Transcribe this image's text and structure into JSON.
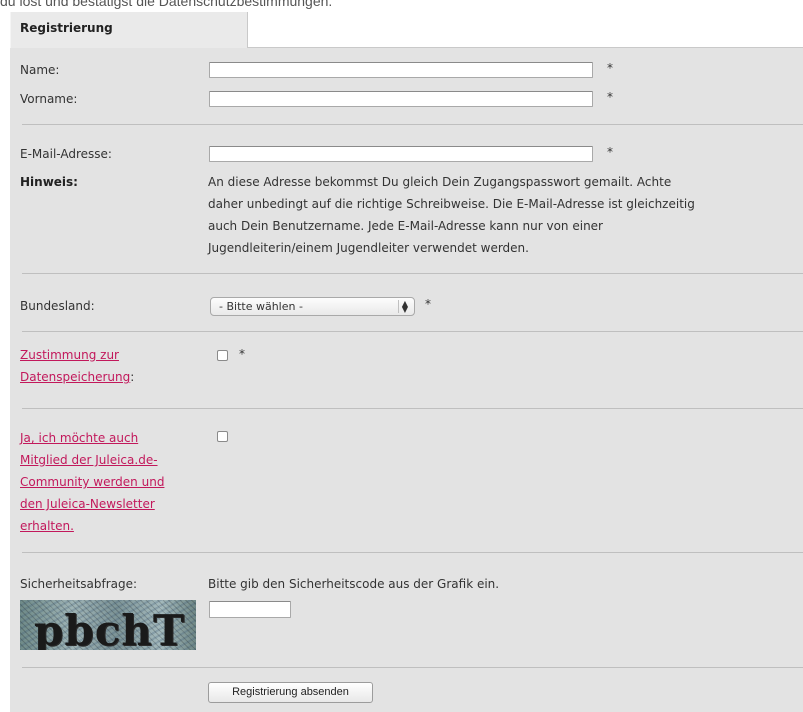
{
  "intro_text": "du löst und bestätigst die Datenschutzbestimmungen.",
  "form": {
    "tab_title": "Registrierung",
    "name_label": "Name:",
    "vorname_label": "Vorname:",
    "email_label": "E-Mail-Adresse:",
    "hinweis_label": "Hinweis:",
    "hinweis_lines": [
      "An diese Adresse bekommst Du gleich Dein Zugangspasswort gemailt. Achte",
      "daher unbedingt auf die richtige Schreibweise. Die E-Mail-Adresse ist gleichzeitig",
      "auch Dein Benutzername. Jede E-Mail-Adresse kann nur von einer",
      "Jugendleiterin/einem Jugendleiter verwendet werden."
    ],
    "bundesland_label": "Bundesland:",
    "bundesland_selected": "- Bitte wählen -",
    "zustimmung_lines": [
      "Zustimmung zur",
      "Datenspeicherung"
    ],
    "zustimmung_suffix": ":",
    "newsletter_lines": [
      "Ja, ich möchte auch",
      "Mitglied der Juleica.de-",
      "Community werden und",
      "den Juleica-Newsletter",
      "erhalten."
    ],
    "security_label": "Sicherheitsabfrage:",
    "security_instruction": "Bitte gib den Sicherheitscode aus der Grafik ein.",
    "captcha_text": "pbchT",
    "submit_label": "Registrierung absenden",
    "required_mark": "*",
    "inputs": {
      "name": "",
      "vorname": "",
      "email": "",
      "security_code": ""
    }
  },
  "colors": {
    "panel_bg": "#e3e3e3",
    "link": "#c2185b"
  }
}
